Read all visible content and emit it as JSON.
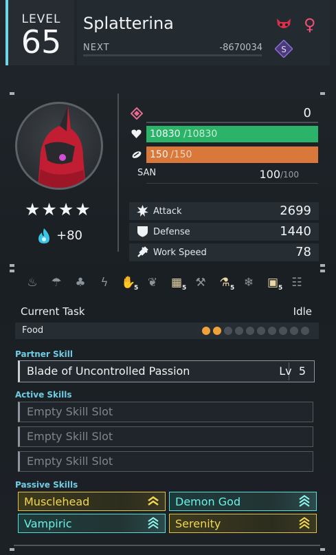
{
  "header": {
    "level_label": "LEVEL",
    "level": "65",
    "name": "Splatterina",
    "next_label": "NEXT",
    "next_value": "-8670034",
    "element_icon": "dark-element-icon",
    "gender_icon": "female-icon",
    "gender_symbol": "♀",
    "rank_icon": "rank-badge-icon"
  },
  "portrait": {
    "icon": "pal-portrait",
    "stars": "★★★★",
    "star_count": 4,
    "soul_icon": "soul-flame-icon",
    "soul_bonus": "+80"
  },
  "stats": {
    "trust_value": "0",
    "hp_current": "10830",
    "hp_max": "/10830",
    "food_current": "150",
    "food_max": "/150",
    "san_label": "SAN",
    "san_current": "100",
    "san_max": "/100",
    "attack_label": "Attack",
    "attack_value": "2699",
    "defense_label": "Defense",
    "defense_value": "1440",
    "workspeed_label": "Work Speed",
    "workspeed_value": "78",
    "hp_fraction": 1.0,
    "food_fraction": 1.0
  },
  "work": {
    "items": [
      {
        "icon": "kindling-icon",
        "glyph": "♨",
        "level": ""
      },
      {
        "icon": "watering-icon",
        "glyph": "☂",
        "level": ""
      },
      {
        "icon": "planting-icon",
        "glyph": "♣",
        "level": ""
      },
      {
        "icon": "electricity-icon",
        "glyph": "ϟ",
        "level": ""
      },
      {
        "icon": "handiwork-icon",
        "glyph": "✋",
        "level": "5",
        "active": true
      },
      {
        "icon": "gathering-icon",
        "glyph": "❦",
        "level": ""
      },
      {
        "icon": "lumbering-icon",
        "glyph": "▦",
        "level": "5",
        "active": true
      },
      {
        "icon": "mining-icon",
        "glyph": "⚒",
        "level": ""
      },
      {
        "icon": "medicine-icon",
        "glyph": "⚗",
        "level": "5",
        "active": true
      },
      {
        "icon": "cooling-icon",
        "glyph": "❄",
        "level": ""
      },
      {
        "icon": "transporting-icon",
        "glyph": "▣",
        "level": "5",
        "active": true
      },
      {
        "icon": "farming-icon",
        "glyph": "☷",
        "level": ""
      }
    ],
    "current_task_label": "Current Task",
    "current_task_value": "Idle",
    "food_label": "Food",
    "food_filled": 2,
    "food_total": 10
  },
  "skills": {
    "partner_title": "Partner Skill",
    "partner_name": "Blade of Uncontrolled Passion",
    "partner_lv_label": "Lv",
    "partner_lv": "5",
    "active_title": "Active Skills",
    "active_slots": [
      "Empty Skill Slot",
      "Empty Skill Slot",
      "Empty Skill Slot"
    ],
    "passive_title": "Passive Skills",
    "passives": [
      {
        "name": "Musclehead",
        "tier": "gold"
      },
      {
        "name": "Demon God",
        "tier": "teal"
      },
      {
        "name": "Vampiric",
        "tier": "teal"
      },
      {
        "name": "Serenity",
        "tier": "gold"
      }
    ]
  },
  "colors": {
    "accent": "#6fd5e8",
    "hp": "#2bb36a",
    "food": "#d9783a",
    "gold": "#e2c443",
    "teal": "#52e0d7"
  }
}
